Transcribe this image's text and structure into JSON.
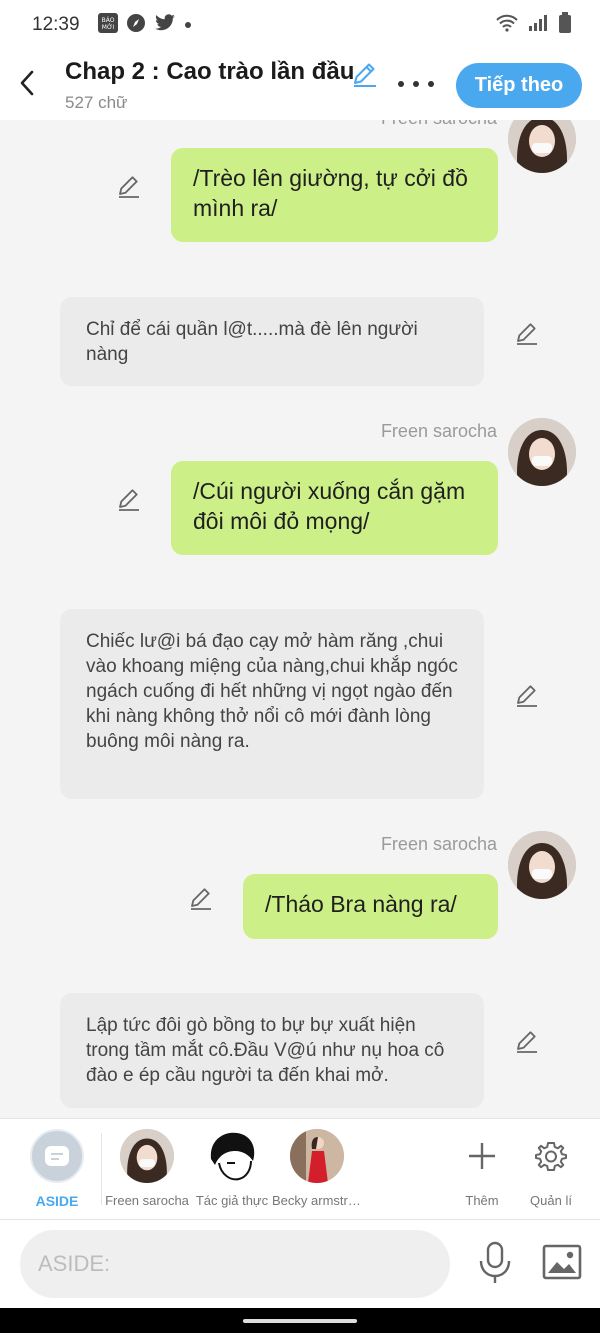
{
  "status_bar": {
    "time": "12:39",
    "left_icons": [
      "baomoi-icon",
      "compass-icon",
      "twitter-icon",
      "dot-icon"
    ],
    "right_icons": [
      "wifi-icon",
      "signal-icon",
      "battery-icon"
    ]
  },
  "header": {
    "title": "Chap 2 : Cao trào lần đầu",
    "word_count": "527 chữ",
    "next_label": "Tiếp theo"
  },
  "messages": [
    {
      "type": "character",
      "sender": "Freen sarocha",
      "text": "/Trèo lên giường, tự cởi đồ mình ra/"
    },
    {
      "type": "aside",
      "text": "Chỉ để cái quần l@t.....mà đè lên người nàng"
    },
    {
      "type": "character",
      "sender": "Freen sarocha",
      "text": "/Cúi người xuống cắn gặm đôi môi đỏ mọng/"
    },
    {
      "type": "aside",
      "text": "Chiếc lư@i bá đạo cạy mở hàm răng ,chui vào khoang miệng của nàng,chui khắp ngóc ngách cuống đi hết những vị ngọt ngào đến khi nàng không thở nổi cô mới đành lòng buông môi nàng ra."
    },
    {
      "type": "character",
      "sender": "Freen sarocha",
      "text": "/Tháo Bra nàng ra/"
    },
    {
      "type": "aside",
      "text": "Lập tức đôi gò bồng to bự bự xuất hiện trong tầm mắt cô.Đầu V@ú như nụ hoa cô đào e ép cầu người ta đến khai mở."
    }
  ],
  "characters": [
    {
      "label": "ASIDE",
      "icon": "aside-chat-icon"
    },
    {
      "label": "Freen sarocha"
    },
    {
      "label": "Tác giả thực"
    },
    {
      "label": "Becky armstrong"
    }
  ],
  "actions": {
    "add_label": "Thêm",
    "manage_label": "Quản lí"
  },
  "input": {
    "placeholder": "ASIDE:"
  },
  "colors": {
    "accent": "#4aa8ef",
    "green_bubble": "#ccef87",
    "gray_bubble": "#ebebeb"
  }
}
